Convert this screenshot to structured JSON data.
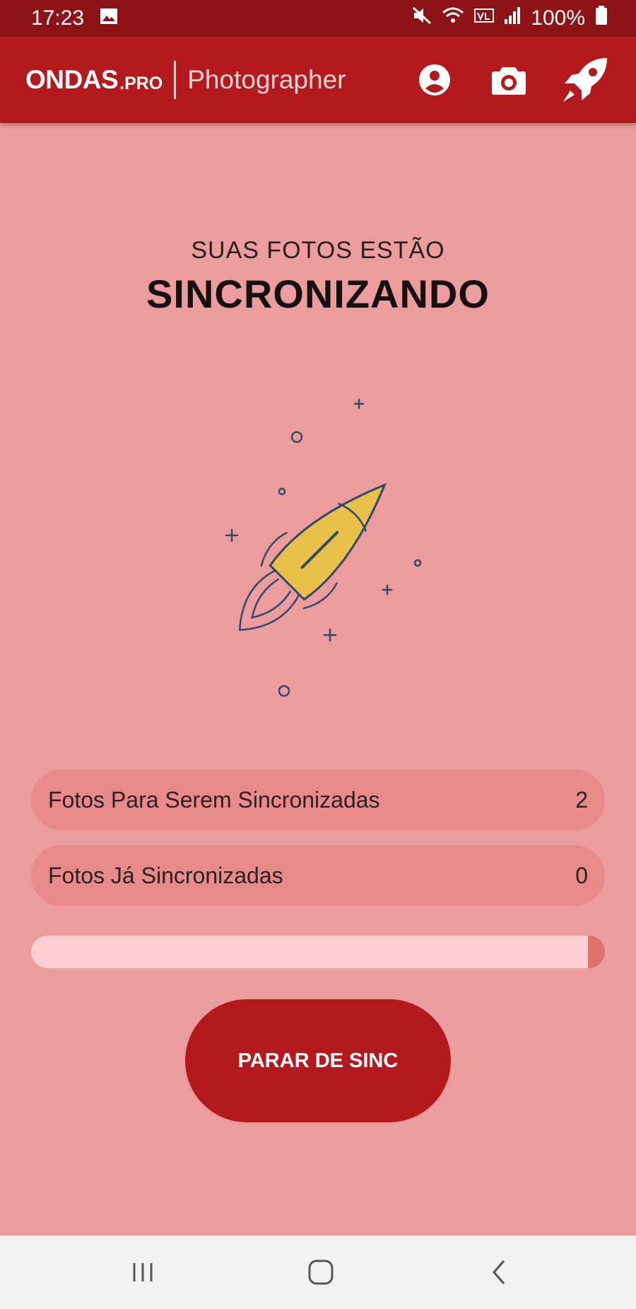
{
  "status_bar": {
    "time": "17:23",
    "battery": "100%",
    "icons": [
      "image-icon",
      "mute-icon",
      "wifi-icon",
      "volte-icon",
      "signal-icon",
      "battery-icon"
    ]
  },
  "app_bar": {
    "brand_main": "ONDAS",
    "brand_suffix": ".PRO",
    "brand_sub": "Photographer",
    "actions": [
      "profile-icon",
      "camera-icon",
      "rocket-icon"
    ]
  },
  "headline": {
    "small": "SUAS FOTOS ESTÃO",
    "big": "SINCRONIZANDO"
  },
  "stats": [
    {
      "label": "Fotos Para Serem Sincronizadas",
      "value": "2"
    },
    {
      "label": "Fotos Já Sincronizadas",
      "value": "0"
    }
  ],
  "progress": {
    "fraction": 0.97
  },
  "stop_button": {
    "label": "PARAR DE SINC"
  },
  "navigation": [
    "recent-apps-icon",
    "home-icon",
    "back-icon"
  ],
  "colors": {
    "background": "#ec9c9c",
    "primary": "#b3191d",
    "status_bar": "#8e1317",
    "rocket_body": "#e9c14a",
    "line": "#2f4a6b"
  }
}
